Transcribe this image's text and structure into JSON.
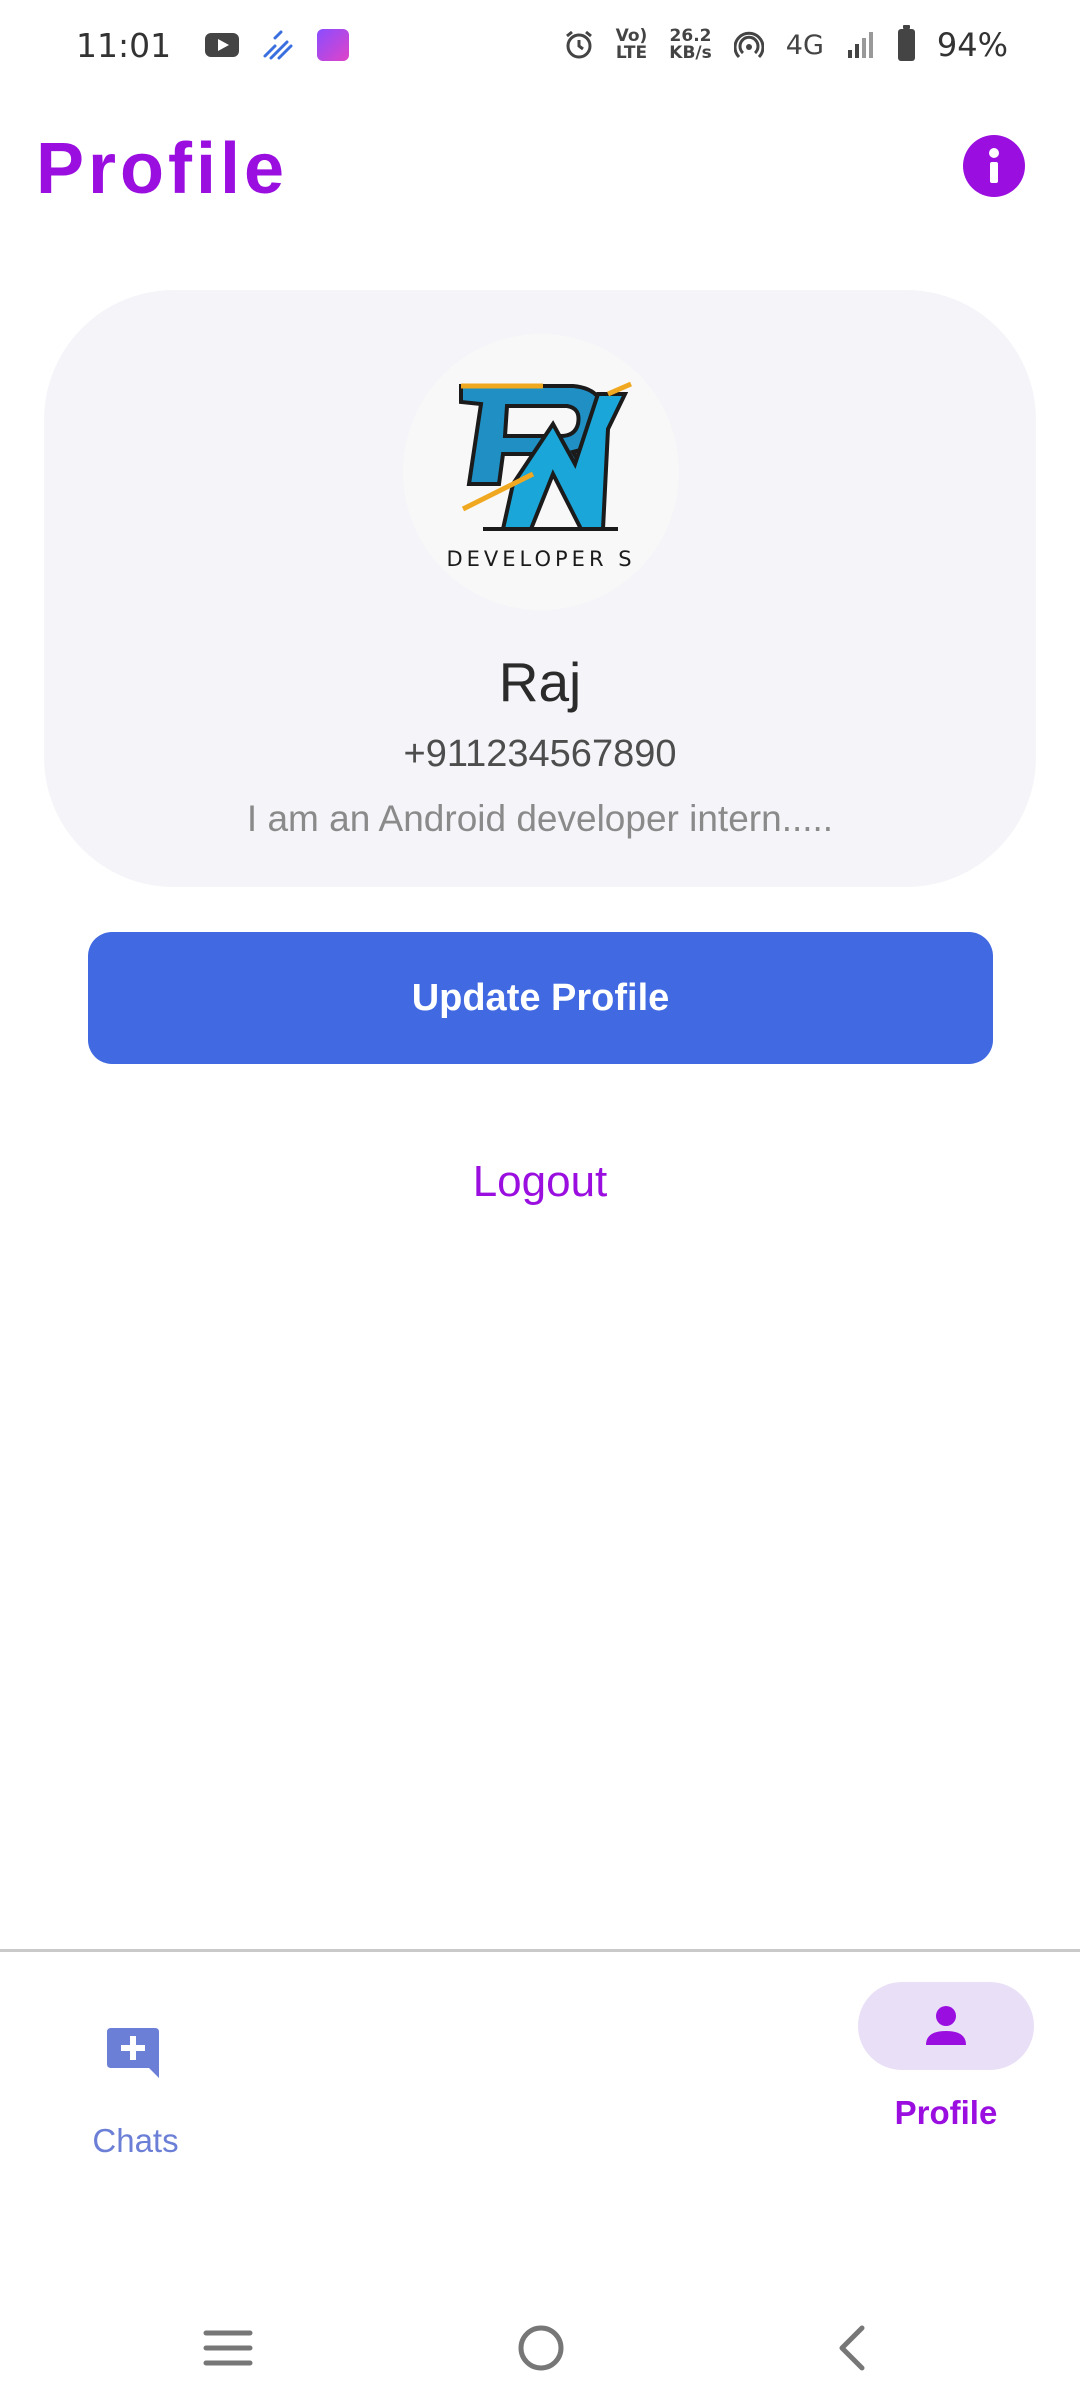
{
  "status_bar": {
    "time": "11:01",
    "network_speed_value": "26.2",
    "network_speed_unit": "KB/s",
    "volte_line1": "Vo)",
    "volte_line2": "LTE",
    "network_type": "4G",
    "battery_percent": "94%",
    "icons": [
      "youtube-icon",
      "signal-app-icon",
      "app-icon",
      "alarm-icon",
      "volte-icon",
      "hotspot-icon",
      "signal-icon",
      "battery-icon"
    ]
  },
  "header": {
    "title": "Profile",
    "info_icon": "info-icon"
  },
  "profile": {
    "avatar_logo_text": "DEVELOPER S",
    "name": "Raj",
    "phone": "+911234567890",
    "bio": "I am an Android developer intern....."
  },
  "actions": {
    "update_label": "Update Profile",
    "logout_label": "Logout"
  },
  "bottom_nav": {
    "items": [
      {
        "label": "Chats",
        "icon": "chat-add-icon",
        "selected": false
      },
      {
        "label": "Profile",
        "icon": "person-icon",
        "selected": true
      }
    ]
  },
  "system_nav": {
    "icons": [
      "menu-icon",
      "home-icon",
      "back-icon"
    ]
  },
  "colors": {
    "accent_purple": "#9a0ee0",
    "button_blue": "#4169e1",
    "card_bg": "#f4f4f9",
    "nav_selected_pill": "#e9dff7",
    "nav_unselected": "#6b7fd6"
  }
}
